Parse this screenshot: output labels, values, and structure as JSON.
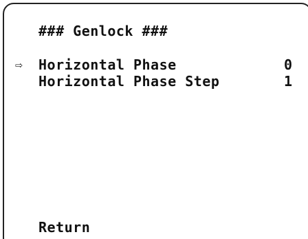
{
  "menu": {
    "title": "### Genlock ###",
    "cursor_icon": "right-arrow-outline",
    "items": [
      {
        "label": "Horizontal Phase",
        "value": "0",
        "selected": true
      },
      {
        "label": "Horizontal Phase Step",
        "value": "1",
        "selected": false
      }
    ],
    "return_label": "Return"
  },
  "colors": {
    "background": "#ffffff",
    "text": "#111111",
    "border": "#222222"
  }
}
